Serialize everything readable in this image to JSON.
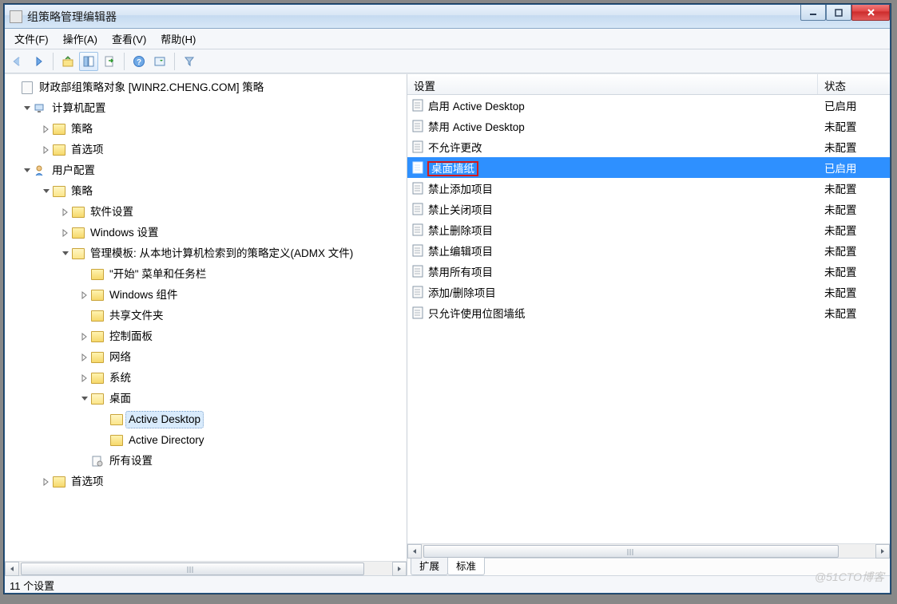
{
  "window": {
    "title": "组策略管理编辑器"
  },
  "menus": {
    "file": "文件(F)",
    "action": "操作(A)",
    "view": "查看(V)",
    "help": "帮助(H)"
  },
  "tree": {
    "root": "财政部组策略对象 [WINR2.CHENG.COM] 策略",
    "computer_config": "计算机配置",
    "cc_policy": "策略",
    "cc_pref": "首选项",
    "user_config": "用户配置",
    "uc_policy": "策略",
    "software": "软件设置",
    "windows_settings": "Windows 设置",
    "admin_templates": "管理模板: 从本地计算机检索到的策略定义(ADMX 文件)",
    "start_menu": "\"开始\" 菜单和任务栏",
    "win_components": "Windows 组件",
    "shared_folders": "共享文件夹",
    "control_panel": "控制面板",
    "network": "网络",
    "system": "系统",
    "desktop": "桌面",
    "active_desktop": "Active Desktop",
    "active_directory": "Active Directory",
    "all_settings": "所有设置",
    "uc_pref": "首选项"
  },
  "columns": {
    "setting": "设置",
    "state": "状态"
  },
  "settings": [
    {
      "label": "启用 Active Desktop",
      "state": "已启用",
      "selected": false
    },
    {
      "label": "禁用 Active Desktop",
      "state": "未配置",
      "selected": false
    },
    {
      "label": "不允许更改",
      "state": "未配置",
      "selected": false
    },
    {
      "label": "桌面墙纸",
      "state": "已启用",
      "selected": true,
      "highlighted": true
    },
    {
      "label": "禁止添加项目",
      "state": "未配置",
      "selected": false
    },
    {
      "label": "禁止关闭项目",
      "state": "未配置",
      "selected": false
    },
    {
      "label": "禁止删除项目",
      "state": "未配置",
      "selected": false
    },
    {
      "label": "禁止编辑项目",
      "state": "未配置",
      "selected": false
    },
    {
      "label": "禁用所有项目",
      "state": "未配置",
      "selected": false
    },
    {
      "label": "添加/删除项目",
      "state": "未配置",
      "selected": false
    },
    {
      "label": "只允许使用位图墙纸",
      "state": "未配置",
      "selected": false
    }
  ],
  "tabs": {
    "extended": "扩展",
    "standard": "标准"
  },
  "status": "11 个设置",
  "watermark": "@51CTO博客"
}
